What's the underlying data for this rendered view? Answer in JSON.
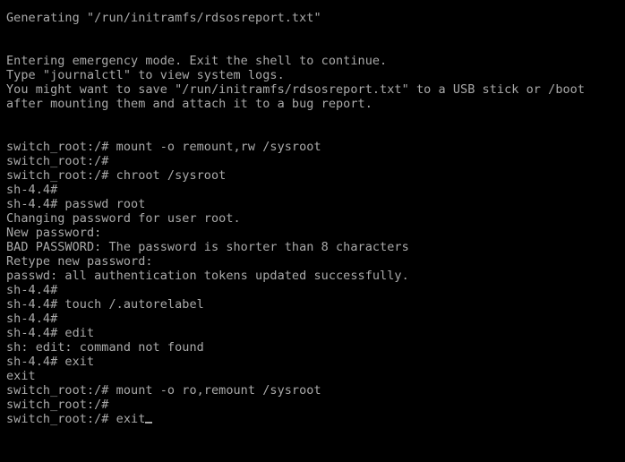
{
  "terminal": {
    "type": "linux-emergency-console",
    "colors": {
      "background": "#000000",
      "foreground": "#aaaaaa"
    },
    "cursor": {
      "visible": true,
      "style": "underscore",
      "after_text": "switch_root:/# exit"
    },
    "lines": [
      "Generating \"/run/initramfs/rdsosreport.txt\"",
      "",
      "",
      "Entering emergency mode. Exit the shell to continue.",
      "Type \"journalctl\" to view system logs.",
      "You might want to save \"/run/initramfs/rdsosreport.txt\" to a USB stick or /boot",
      "after mounting them and attach it to a bug report.",
      "",
      "",
      "switch_root:/# mount -o remount,rw /sysroot",
      "switch_root:/#",
      "switch_root:/# chroot /sysroot",
      "sh-4.4#",
      "sh-4.4# passwd root",
      "Changing password for user root.",
      "New password:",
      "BAD PASSWORD: The password is shorter than 8 characters",
      "Retype new password:",
      "passwd: all authentication tokens updated successfully.",
      "sh-4.4#",
      "sh-4.4# touch /.autorelabel",
      "sh-4.4#",
      "sh-4.4# edit",
      "sh: edit: command not found",
      "sh-4.4# exit",
      "exit",
      "switch_root:/# mount -o ro,remount /sysroot",
      "switch_root:/#",
      "switch_root:/# exit"
    ]
  }
}
